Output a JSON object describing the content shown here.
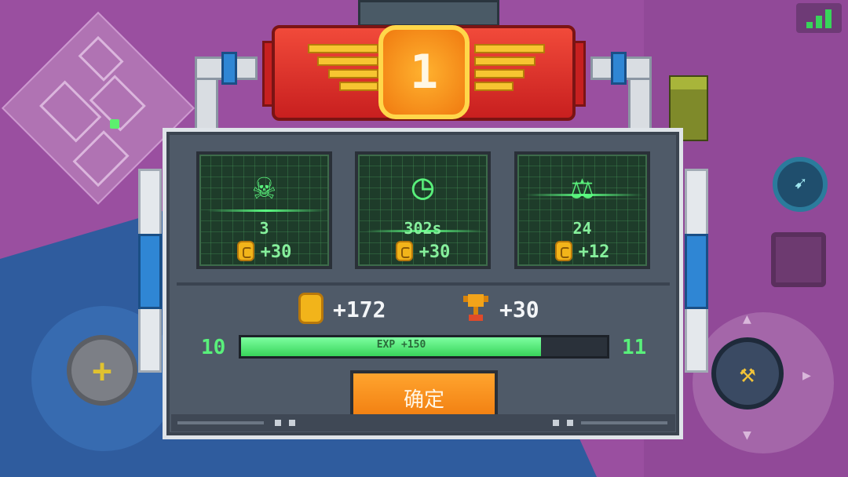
{
  "hud": {
    "signal_icon": "signal-bars-icon",
    "skill_icon": "skill-icon",
    "joystick_icon": "plus-icon",
    "attack_icon": "weapon-icon"
  },
  "result": {
    "rank": "1",
    "stats": [
      {
        "icon": "skull-icon",
        "glyph": "☠",
        "value": "3",
        "reward": "+30"
      },
      {
        "icon": "clock-icon",
        "glyph": "◷",
        "value": "302s",
        "reward": "+30"
      },
      {
        "icon": "weight-icon",
        "glyph": "⚖",
        "value": "24",
        "reward": "+12"
      }
    ],
    "total_coins": "+172",
    "trophies": "+30",
    "level_current": "10",
    "level_next": "11",
    "exp_label": "EXP +150",
    "exp_progress": 0.82,
    "confirm_label": "确定"
  },
  "colors": {
    "accent_green": "#59f07b",
    "confirm_orange": "#f07b0e",
    "banner_red": "#d42a24"
  }
}
